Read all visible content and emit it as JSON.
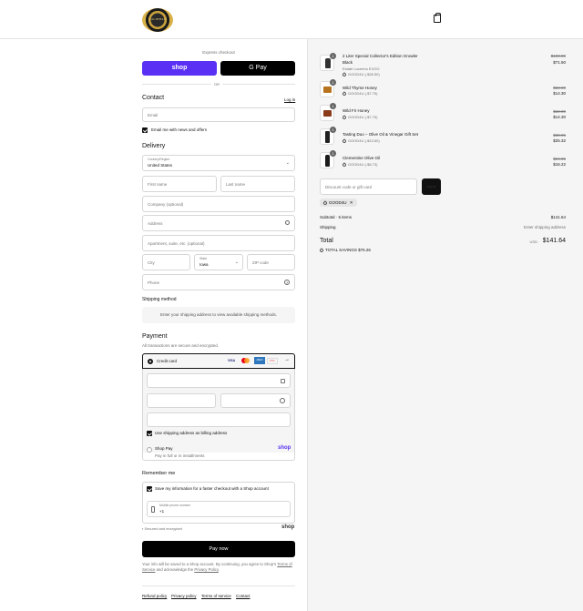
{
  "header": {
    "logo_text": "CALIBRAN"
  },
  "express": {
    "title": "Express checkout",
    "shop_pay": "shop",
    "google_pay": "G Pay",
    "or": "OR"
  },
  "contact": {
    "title": "Contact",
    "login": "Log in",
    "email_placeholder": "Email",
    "news_label": "Email me with news and offers"
  },
  "delivery": {
    "title": "Delivery",
    "country_label": "Country/Region",
    "country_value": "United States",
    "first_name": "First name",
    "last_name": "Last name",
    "company": "Company (optional)",
    "address": "Address",
    "apartment": "Apartment, suite, etc. (optional)",
    "city": "City",
    "state_label": "State",
    "state_value": "Iowa",
    "zip": "ZIP code",
    "phone": "Phone"
  },
  "shipping": {
    "title": "Shipping method",
    "message": "Enter your shipping address to view available shipping methods."
  },
  "payment": {
    "title": "Payment",
    "subtitle": "All transactions are secure and encrypted.",
    "credit_card": "Credit card",
    "card_brands": [
      "VISA",
      "MC",
      "AMEX",
      "DISC"
    ],
    "billing_label": "Use shipping address as billing address",
    "shop_pay_label": "Shop Pay",
    "shop_pay_sub": "Pay in full or in installments",
    "shop_pay_badge": "shop"
  },
  "remember": {
    "title": "Remember me",
    "save_label": "Save my information for a faster checkout with a Shop account",
    "phone_label": "Mobile phone number",
    "phone_value": "+1",
    "secure": "Secured and encrypted",
    "shop_logo": "shop"
  },
  "pay_button": "Pay now",
  "legal": {
    "text1": "Your info will be saved to a Shop account. By continuing, you agree to Shop's",
    "terms": "Terms of Service",
    "and": "and acknowledge the",
    "privacy": "Privacy Policy"
  },
  "footer_links": [
    "Refund policy",
    "Privacy policy",
    "Terms of service",
    "Contact"
  ],
  "cart": {
    "items": [
      {
        "name": "2 Liter Special Collector's Edition Growler",
        "name2": "Black",
        "variant": "Estate Lucerino EVOO",
        "discount": "GOOD4U (-$28.50)",
        "original": "$100.00",
        "price": "$71.50",
        "qty": "1"
      },
      {
        "name": "Wild Thyme Honey",
        "discount": "GOOD4U (-$7.75)",
        "original": "$22.00",
        "price": "$14.30",
        "qty": "1"
      },
      {
        "name": "Wild Fir Honey",
        "discount": "GOOD4U (-$7.75)",
        "original": "$22.00",
        "price": "$14.30",
        "qty": "1"
      },
      {
        "name": "Tasting Duo – Olive Oil & Vinegar Gift Set",
        "discount": "GOOD4U (-$13.60)",
        "original": "$38.95",
        "price": "$25.32",
        "qty": "1"
      },
      {
        "name": "Clementine Olive Oil",
        "discount": "GOOD4U (-$8.73)",
        "original": "$24.95",
        "price": "$16.22",
        "qty": "1"
      }
    ],
    "discount_placeholder": "Discount code or gift card",
    "apply": "Apply",
    "code": "GOOD4U",
    "subtotal_label": "Subtotal · 5 items",
    "subtotal": "$141.64",
    "shipping_label": "Shipping",
    "shipping_value": "Enter shipping address",
    "total_label": "Total",
    "currency": "USD",
    "total": "$141.64",
    "savings": "TOTAL SAVINGS $76.26"
  },
  "colors": {
    "shop_purple": "#5a31f4",
    "dark": "#111111"
  }
}
